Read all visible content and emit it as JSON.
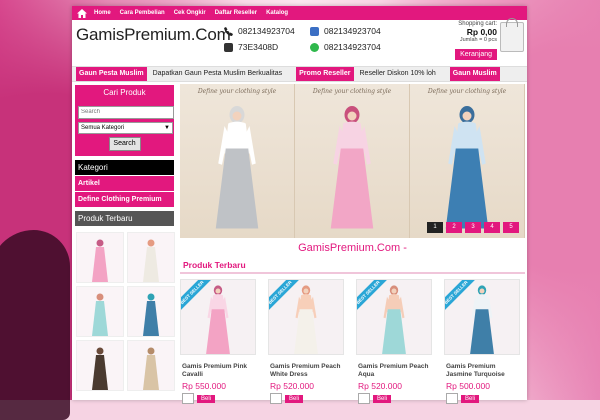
{
  "nav": {
    "items": [
      "Home",
      "Cara Pembelian",
      "Cek Ongkir",
      "Daftar Reseller",
      "Katalog"
    ]
  },
  "header": {
    "logo": "GamisPremium.Com",
    "phone1": "082134923704",
    "phone2": "082134923704",
    "pin": "73E3408D",
    "whatsapp": "082134923704"
  },
  "cart": {
    "title": "Shopping cart:",
    "total": "Rp 0,00",
    "count": "Jumlah = 0 pcs",
    "button": "Keranjang"
  },
  "ticker": [
    {
      "text": "Gaun Pesta Muslim",
      "style": "pink"
    },
    {
      "text": "Dapatkan Gaun Pesta Muslim Berkualitas",
      "style": "plain"
    },
    {
      "text": "Promo Reseller",
      "style": "pink"
    },
    {
      "text": "Reseller Diskon 10% loh",
      "style": "plain"
    },
    {
      "text": "Gaun Muslim",
      "style": "pink"
    }
  ],
  "search": {
    "title": "Cari Produk",
    "placeholder": "Search",
    "category": "Semua Kategori",
    "button": "Search"
  },
  "kategori": {
    "title": "Kategori",
    "items": [
      "Artikel",
      "Define Clothing Premium"
    ]
  },
  "sidebar_products": {
    "title": "Produk Terbaru"
  },
  "slider": {
    "tagline": "Define your clothing style",
    "dresses": [
      {
        "body": "#bfc2c6",
        "top": "#ffffff",
        "hijab": "#d8d8d8"
      },
      {
        "body": "#f2a6c6",
        "top": "#f7d3e3",
        "hijab": "#c9507c"
      },
      {
        "body": "#3d7fb3",
        "top": "#cfe3f2",
        "hijab": "#3a6e9c"
      }
    ],
    "pages": [
      "1",
      "2",
      "3",
      "4",
      "5"
    ],
    "active_page": "1"
  },
  "main": {
    "site_title": "GamisPremium.Com -",
    "section_title": "Produk Terbaru"
  },
  "products": [
    {
      "name": "Gamis Premium Pink Cavalli",
      "price": "Rp 550.000",
      "badge": "BEST SELLER",
      "body": "#f3a3c4",
      "top": "#f9d6e5",
      "hijab": "#c65c86"
    },
    {
      "name": "Gamis Premium Peach White Dress",
      "price": "Rp 520.000",
      "badge": "BEST SELLER",
      "body": "#f4f1ea",
      "top": "#f7cfb9",
      "hijab": "#e59b82"
    },
    {
      "name": "Gamis Premium Peach Aqua",
      "price": "Rp 520.000",
      "badge": "BEST SELLER",
      "body": "#9ed8d8",
      "top": "#f5cdb8",
      "hijab": "#d88f7c"
    },
    {
      "name": "Gamis Premium Jasmine Turquoise",
      "price": "Rp 500.000",
      "badge": "BEST SELLER",
      "body": "#3f7fa8",
      "top": "#eef3f6",
      "hijab": "#2fa3b5"
    }
  ],
  "buy_label": "Beli",
  "colors": {
    "accent": "#e2187e",
    "dark": "#222222"
  }
}
